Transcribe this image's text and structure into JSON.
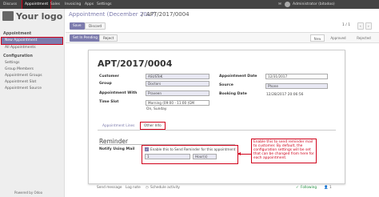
{
  "topbar": {
    "items": [
      "Discuss",
      "Appointment",
      "Sales",
      "Invoicing",
      "Apps",
      "Settings"
    ],
    "user": "Administrator (bitodoo)"
  },
  "brand": {
    "logo_text": "Your logo",
    "powered": "Powered by Odoo"
  },
  "sidebar": {
    "head1": "Appointment",
    "items1": [
      "New Appointment",
      "All Appointments"
    ],
    "head2": "Configuration",
    "items2": [
      "Settings",
      "Group Members",
      "Appointment Groups",
      "Appointment Slot",
      "Appointment Source"
    ]
  },
  "breadcrumb": {
    "parent": "Appointment (December 2017)",
    "sep": "/",
    "current": "APT/2017/0004"
  },
  "toolbar": {
    "save": "Save",
    "discard": "Discard",
    "pager": "1 / 1"
  },
  "header_buttons": {
    "set_pending": "Set In Pending",
    "reject": "Reject"
  },
  "status": [
    "New",
    "Approved",
    "Rejected"
  ],
  "form": {
    "title": "APT/2017/0004",
    "labels": {
      "customer": "Customer",
      "group": "Group",
      "appointment_with": "Appointment With",
      "time_slot": "Time Slot",
      "appointment_date": "Appointment Date",
      "source": "Source",
      "booking_date": "Booking Date"
    },
    "values": {
      "customer": "ASUSTeK",
      "group": "Doctors",
      "appointment_with": "Praveen",
      "time_slot": "Morning (09:00 - 11:00 (GM",
      "time_slot_day": "On, Sunday",
      "appointment_date": "12/31/2017",
      "source": "Phone",
      "booking_date": "12/28/2017 20:06:56"
    },
    "tabs": [
      "Appointment Lines",
      "Other Info"
    ],
    "section": "Reminder",
    "notify_label": "Notify Using Mail",
    "checkbox_label": "Enable this to Send Reminder for this appointment",
    "reminder_value": "1",
    "reminder_unit": "Hour(s)"
  },
  "annotation": "Enable this to send reminder mail to customer. By default, the configuration settings will be set that can be changed from here for each appointment.",
  "chatter": {
    "send_message": "Send message",
    "log_note": "Log note",
    "schedule": "Schedule activity",
    "following": "Following",
    "followers": "1"
  },
  "colors": {
    "accent": "#7c7bad",
    "highlight": "#d0021b",
    "topbar": "#444444"
  }
}
